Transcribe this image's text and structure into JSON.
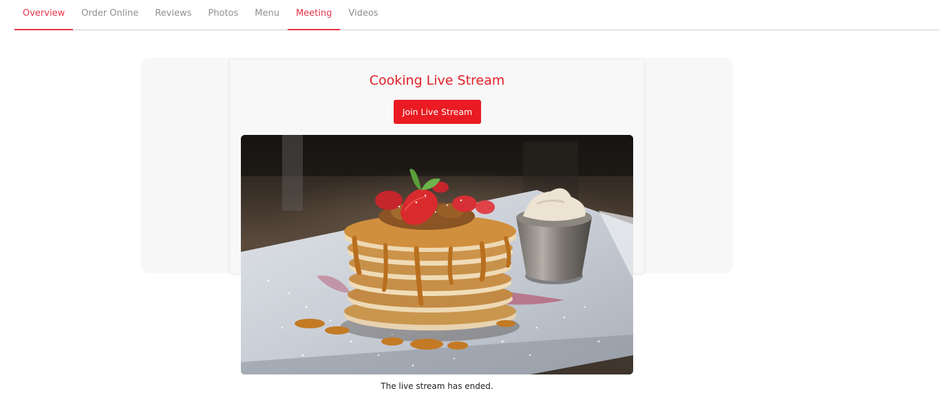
{
  "tabs": [
    {
      "label": "Overview",
      "active": true
    },
    {
      "label": "Order Online",
      "active": false
    },
    {
      "label": "Reviews",
      "active": false
    },
    {
      "label": "Photos",
      "active": false
    },
    {
      "label": "Menu",
      "active": false
    },
    {
      "label": "Meeting",
      "active": true
    },
    {
      "label": "Videos",
      "active": false
    }
  ],
  "stream": {
    "title": "Cooking Live Stream",
    "join_label": "Join Live Stream",
    "caption": "The live stream has ended."
  },
  "colors": {
    "accent": "#e8334a",
    "button": "#ea1b22",
    "title": "#e21f26"
  }
}
